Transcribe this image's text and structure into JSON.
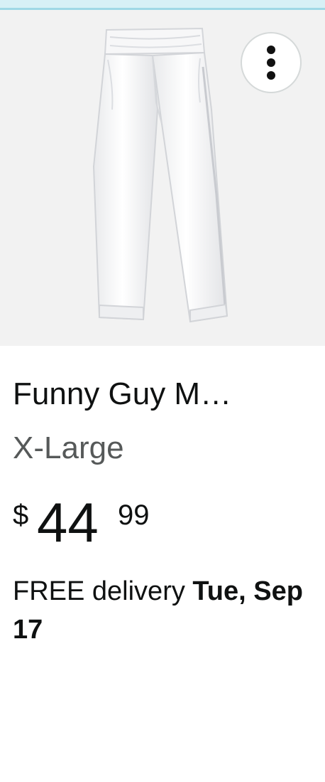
{
  "product": {
    "title": "Funny Guy M…",
    "variant": "X-Large",
    "price": {
      "symbol": "$",
      "whole": "44",
      "fraction": "99"
    },
    "delivery": {
      "prefix": "FREE delivery ",
      "date": "Tue, Sep 17"
    },
    "image_icon": "white-pants-photo"
  },
  "actions": {
    "more_icon": "vertical-ellipsis-icon"
  },
  "colors": {
    "top_strip": "#d7f0f6",
    "image_background": "#f2f2f2",
    "variant_text": "#565959",
    "primary_text": "#0f1111"
  }
}
